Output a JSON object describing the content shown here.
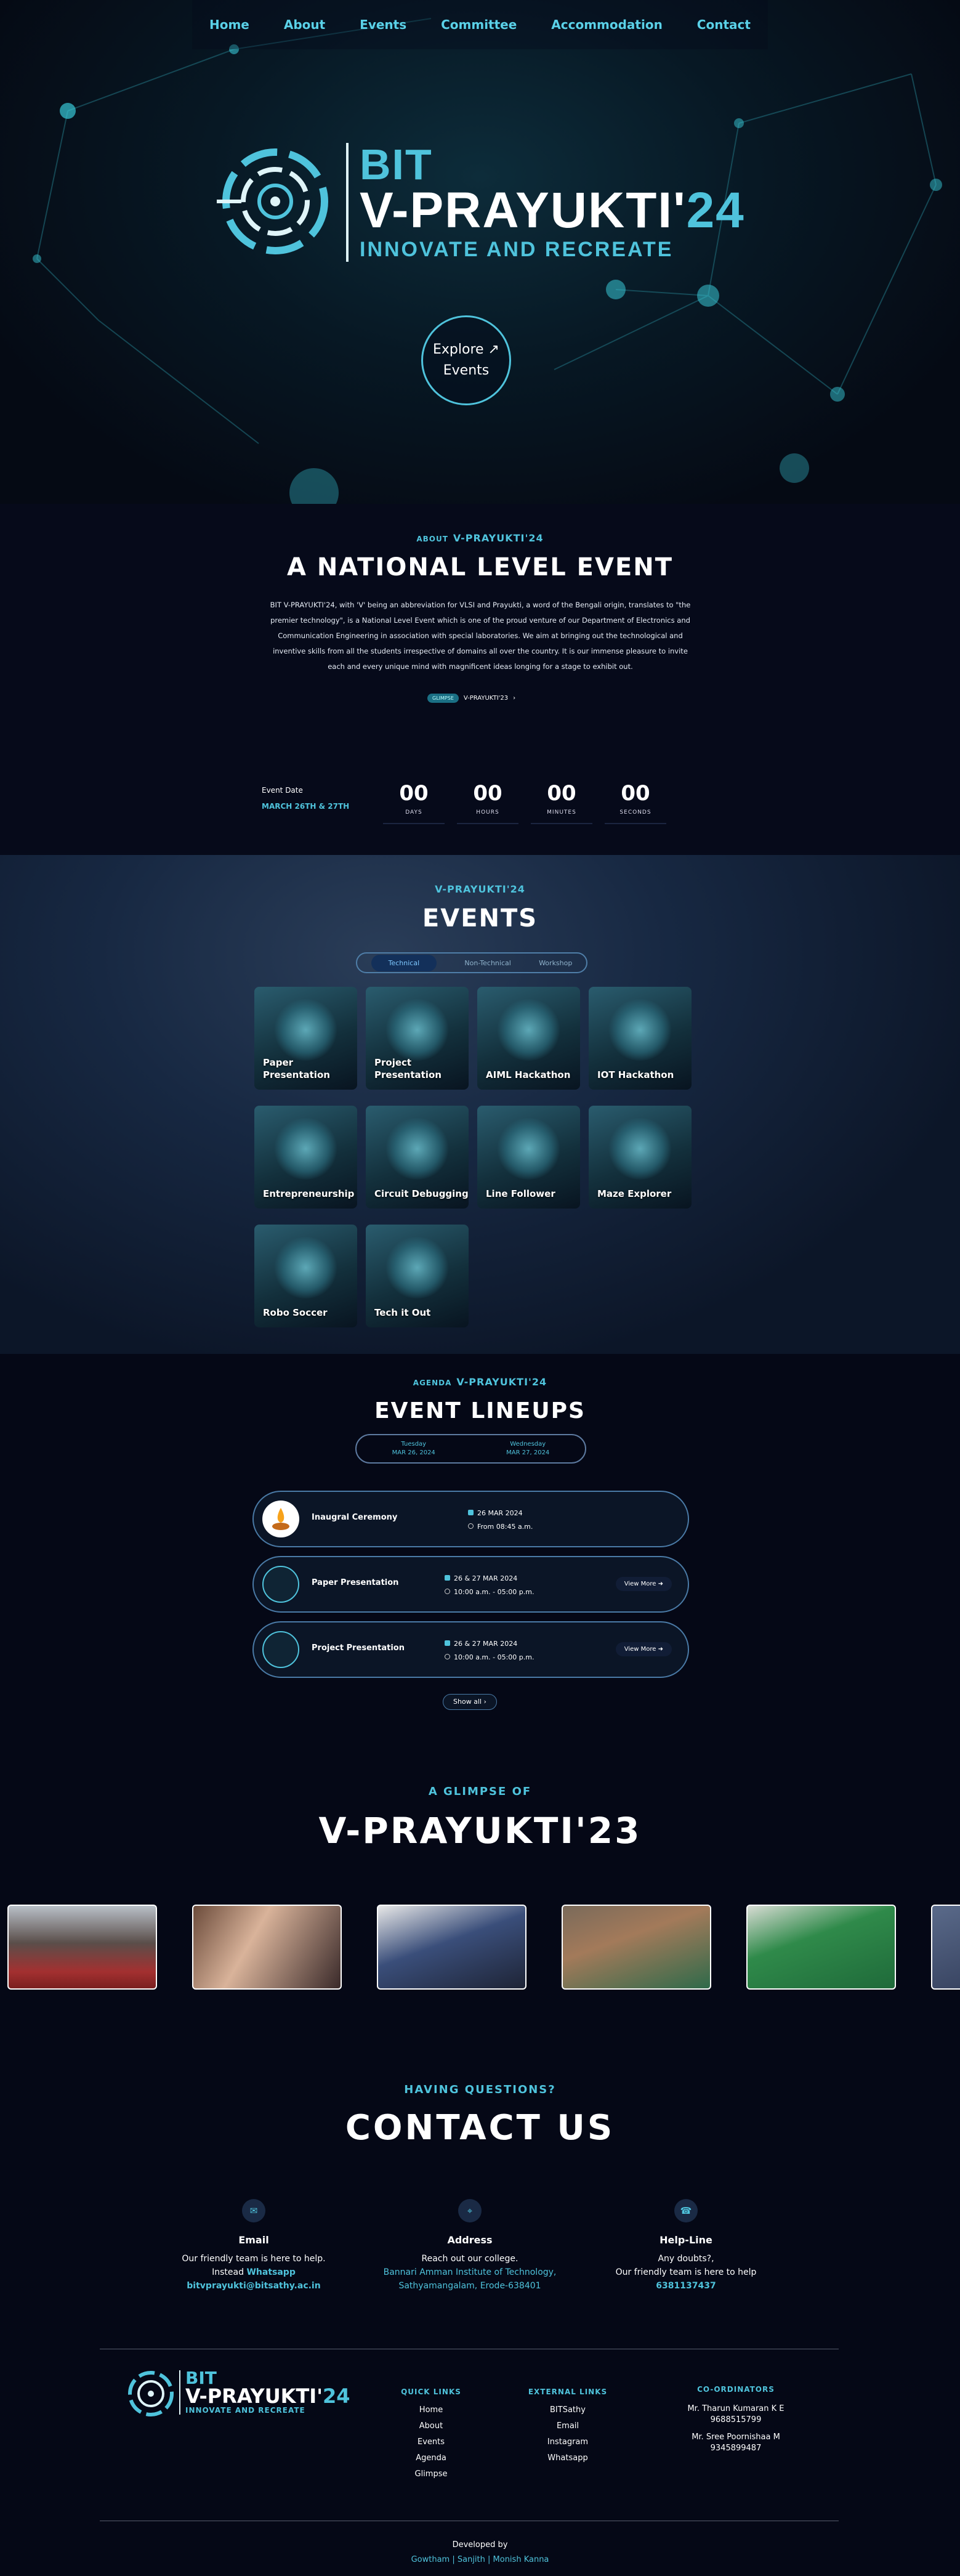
{
  "nav": {
    "items": [
      "Home",
      "About",
      "Events",
      "Committee",
      "Accommodation",
      "Contact"
    ]
  },
  "hero": {
    "logo_bit": "BIT",
    "logo_main": "V-PRAYUKTI'",
    "logo_year": "24",
    "logo_tagline": "INNOVATE AND RECREATE",
    "explore_line1": "Explore ↗",
    "explore_line2": "Events"
  },
  "about": {
    "label_small": "ABOUT",
    "label_big": "V-PRAYUKTI'24",
    "title": "A NATIONAL LEVEL EVENT",
    "body": "BIT V-PRAYUKTI'24, with 'V' being an abbreviation for VLSI and Prayukti, a word of the Bengali origin, translates to \"the premier technology\", is a National Level Event which is one of the proud venture of our Department of Electronics and Communication Engineering in association with special laboratories. We aim at bringing out the technological and inventive skills from all the students irrespective of domains all over the country. It is our immense pleasure to invite each and every unique mind with magnificent ideas longing for a stage to exhibit out.",
    "glimpse_tag": "GLIMPSE",
    "glimpse_link": "V-PRAYUKTI'23",
    "event_date_label": "Event Date",
    "event_date_value": "MARCH 26TH & 27TH",
    "countdown": [
      {
        "value": "00",
        "label": "DAYS"
      },
      {
        "value": "00",
        "label": "HOURS"
      },
      {
        "value": "00",
        "label": "MINUTES"
      },
      {
        "value": "00",
        "label": "SECONDS"
      }
    ]
  },
  "events": {
    "label": "V-PRAYUKTI'24",
    "title": "EVENTS",
    "tabs": [
      "Technical",
      "Non-Technical",
      "Workshop"
    ],
    "cards": [
      "Paper Presentation",
      "Project Presentation",
      "AIML Hackathon",
      "IOT Hackathon",
      "Entrepreneurship",
      "Circuit Debugging",
      "Line Follower",
      "Maze Explorer",
      "Robo Soccer",
      "Tech it Out"
    ]
  },
  "lineups": {
    "label_small": "AGENDA",
    "label_big": "V-PRAYUKTI'24",
    "title": "EVENT LINEUPS",
    "days": [
      {
        "name": "Tuesday",
        "date": "MAR 26, 2024"
      },
      {
        "name": "Wednesday",
        "date": "MAR 27, 2024"
      }
    ],
    "items": [
      {
        "title": "Inaugral Ceremony",
        "date": "26 MAR 2024",
        "time": "From 08:45 a.m.",
        "button": ""
      },
      {
        "title": "Paper Presentation",
        "date": "26 & 27 MAR 2024",
        "time": "10:00 a.m. - 05:00 p.m.",
        "button": "View More"
      },
      {
        "title": "Project Presentation",
        "date": "26 & 27 MAR 2024",
        "time": "10:00 a.m. - 05:00 p.m.",
        "button": "View More"
      }
    ],
    "show_all": "Show all"
  },
  "glimpse": {
    "label": "A GLIMPSE OF",
    "title": "V-PRAYUKTI'23"
  },
  "contact": {
    "label": "HAVING QUESTIONS?",
    "title": "CONTACT US",
    "email": {
      "title": "Email",
      "line1": "Our friendly team is here to help.",
      "line2_prefix": "Instead",
      "line2_link": "Whatsapp",
      "address": "bitvprayukti@bitsathy.ac.in"
    },
    "address": {
      "title": "Address",
      "line1": "Reach out our college.",
      "line2": "Bannari Amman Institute of Technology,",
      "line3": "Sathyamangalam, Erode-638401"
    },
    "helpline": {
      "title": "Help-Line",
      "line1": "Any doubts?,",
      "line2": "Our friendly team is here to help",
      "number": "6381137437"
    }
  },
  "footer": {
    "quick_links_title": "QUICK LINKS",
    "quick_links": [
      "Home",
      "About",
      "Events",
      "Agenda",
      "Glimpse"
    ],
    "external_title": "EXTERNAL LINKS",
    "external_links": [
      "BITSathy",
      "Email",
      "Instagram",
      "Whatsapp"
    ],
    "coord_title": "CO-ORDINATORS",
    "coordinators": [
      {
        "name": "Mr. Tharun Kumaran K E",
        "phone": "9688515799"
      },
      {
        "name": "Mr. Sree Poornishaa M",
        "phone": "9345899487"
      }
    ],
    "developed_by": "Developed by",
    "developers": "Gowtham | Sanjith | Monish Kanna"
  },
  "colors": {
    "accent": "#4fc3dc",
    "background": "#050816",
    "card_border": "#4a7aa6"
  }
}
